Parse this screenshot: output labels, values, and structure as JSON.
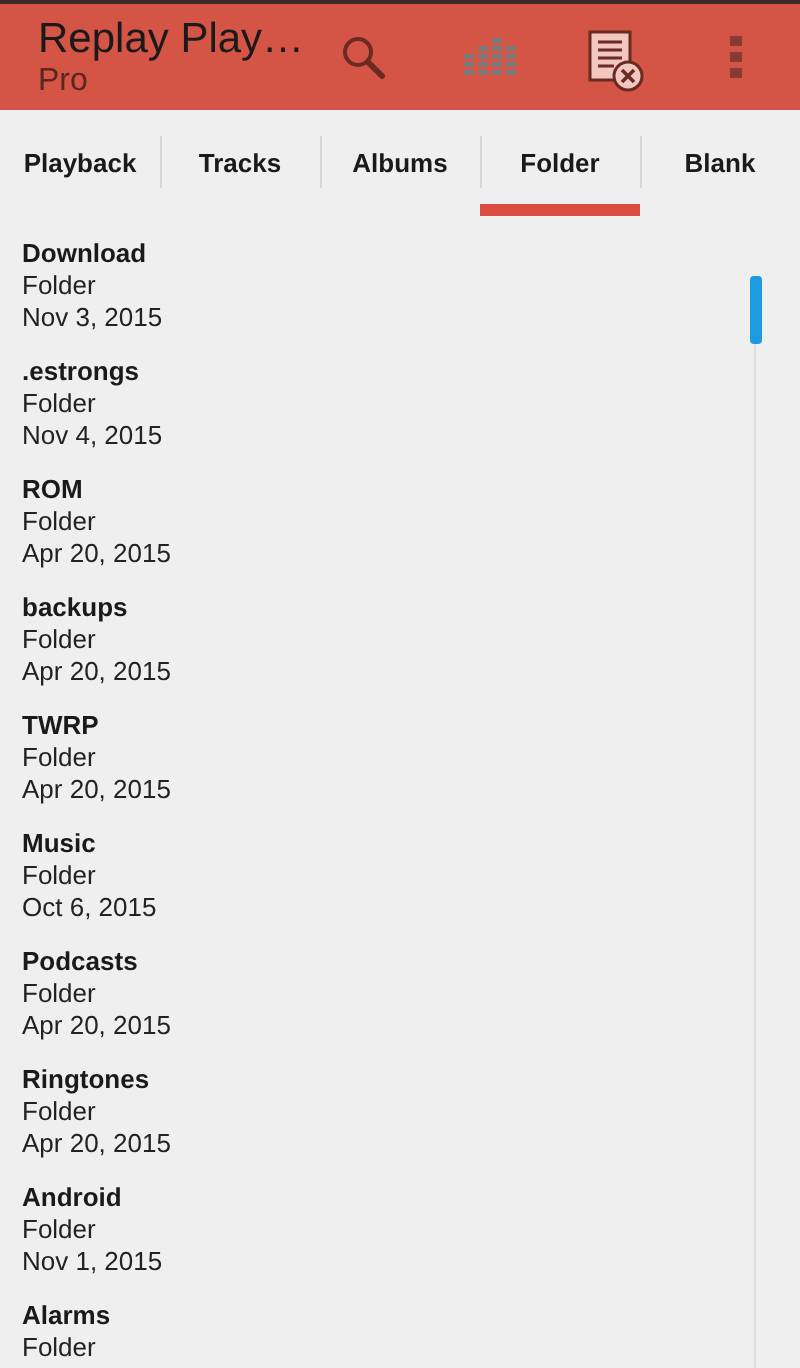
{
  "app_bar": {
    "title": "Replay Play…",
    "subtitle": "Pro"
  },
  "tabs": [
    {
      "label": "Playback",
      "selected": false
    },
    {
      "label": "Tracks",
      "selected": false
    },
    {
      "label": "Albums",
      "selected": false
    },
    {
      "label": "Folder",
      "selected": true
    },
    {
      "label": "Blank",
      "selected": false
    }
  ],
  "items": [
    {
      "name": "Download",
      "type": "Folder",
      "date": "Nov 3, 2015"
    },
    {
      "name": ".estrongs",
      "type": "Folder",
      "date": "Nov 4, 2015"
    },
    {
      "name": "ROM",
      "type": "Folder",
      "date": "Apr 20, 2015"
    },
    {
      "name": "backups",
      "type": "Folder",
      "date": "Apr 20, 2015"
    },
    {
      "name": "TWRP",
      "type": "Folder",
      "date": "Apr 20, 2015"
    },
    {
      "name": "Music",
      "type": "Folder",
      "date": "Oct 6, 2015"
    },
    {
      "name": "Podcasts",
      "type": "Folder",
      "date": "Apr 20, 2015"
    },
    {
      "name": "Ringtones",
      "type": "Folder",
      "date": "Apr 20, 2015"
    },
    {
      "name": "Android",
      "type": "Folder",
      "date": "Nov 1, 2015"
    },
    {
      "name": "Alarms",
      "type": "Folder"
    }
  ]
}
